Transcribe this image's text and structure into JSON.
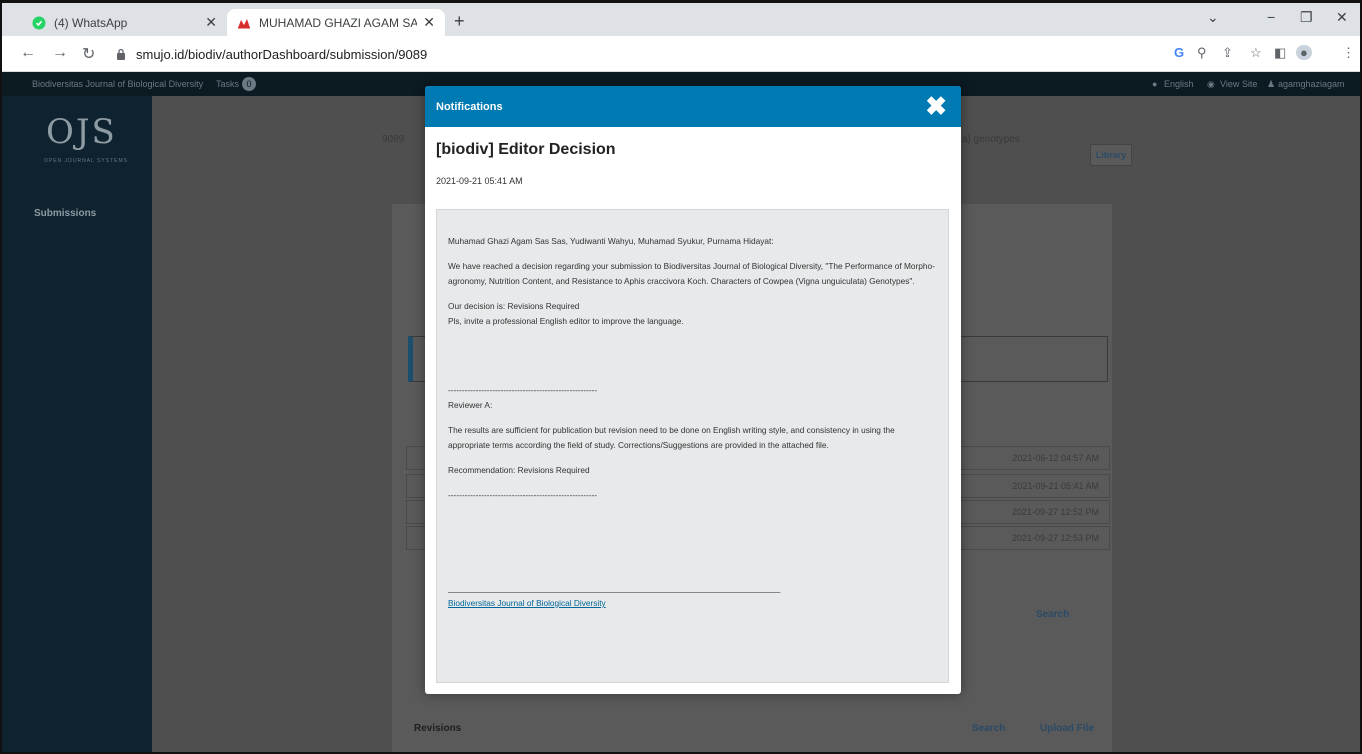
{
  "browser": {
    "tabs": [
      {
        "title": "(4) WhatsApp",
        "active": false
      },
      {
        "title": "MUHAMAD GHAZI AGAM SAS, M",
        "active": true
      }
    ],
    "new_tab": "+",
    "url": "smujo.id/biodiv/authorDashboard/submission/9089"
  },
  "ojs": {
    "journal_name": "Biodiversitas Journal of Biological Diversity",
    "tasks_label": "Tasks",
    "tasks_count": "0",
    "language": "English",
    "view_site": "View Site",
    "username": "agamghaziagam",
    "logo": "OJS",
    "logo_sub": "OPEN JOURNAL SYSTEMS",
    "sidebar_item": "Submissions",
    "submission_id": "9089",
    "title_fragment": "a) genotypes",
    "library_button": "Library",
    "panel_search": "Search",
    "revisions_label": "Revisions",
    "revisions_search": "Search",
    "upload_file": "Upload File",
    "notification_dates": [
      "2021-06-12 04:57 AM",
      "2021-09-21 05:41 AM",
      "2021-09-27 12:52 PM",
      "2021-09-27 12:53 PM"
    ]
  },
  "modal": {
    "header": "Notifications",
    "title": "[biodiv] Editor Decision",
    "date": "2021-09-21 05:41 AM",
    "salutation": "Muhamad Ghazi Agam Sas Sas, Yudiwanti Wahyu, Muhamad Syukur, Purnama Hidayat:",
    "intro": "We have reached a decision regarding your submission to Biodiversitas Journal of Biological Diversity, \"The Performance of Morpho-agronomy, Nutrition Content, and Resistance to Aphis craccivora Koch. Characters of Cowpea (Vigna unguiculata) Genotypes\".",
    "decision": "Our decision is: Revisions Required",
    "note": "Pls, invite a professional English editor to improve the language.",
    "separator": "------------------------------------------------------",
    "reviewer": "Reviewer A:",
    "review_text": "The results are sufficient for publication but revision need to be done on English writing style, and consistency in using the appropriate terms according the field of study. Corrections/Suggestions are provided in the attached file.",
    "recommendation": "Recommendation: Revisions Required",
    "separator2": "------------------------------------------------------",
    "footer_line": "________________________________________________________________________",
    "footer_link": "Biodiversitas Journal of Biological Diversity"
  }
}
